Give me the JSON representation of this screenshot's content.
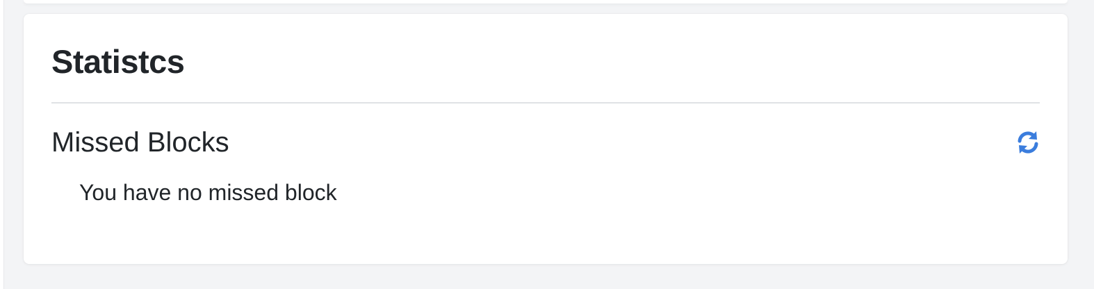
{
  "card": {
    "title": "Statistcs"
  },
  "missed_blocks": {
    "title": "Missed Blocks",
    "refresh_icon": "refresh-icon",
    "empty_message": "You have no missed block"
  },
  "colors": {
    "accent": "#3b7ddd",
    "text": "#212529",
    "divider": "#dfe2e5",
    "background": "#f3f4f6",
    "card": "#ffffff"
  }
}
